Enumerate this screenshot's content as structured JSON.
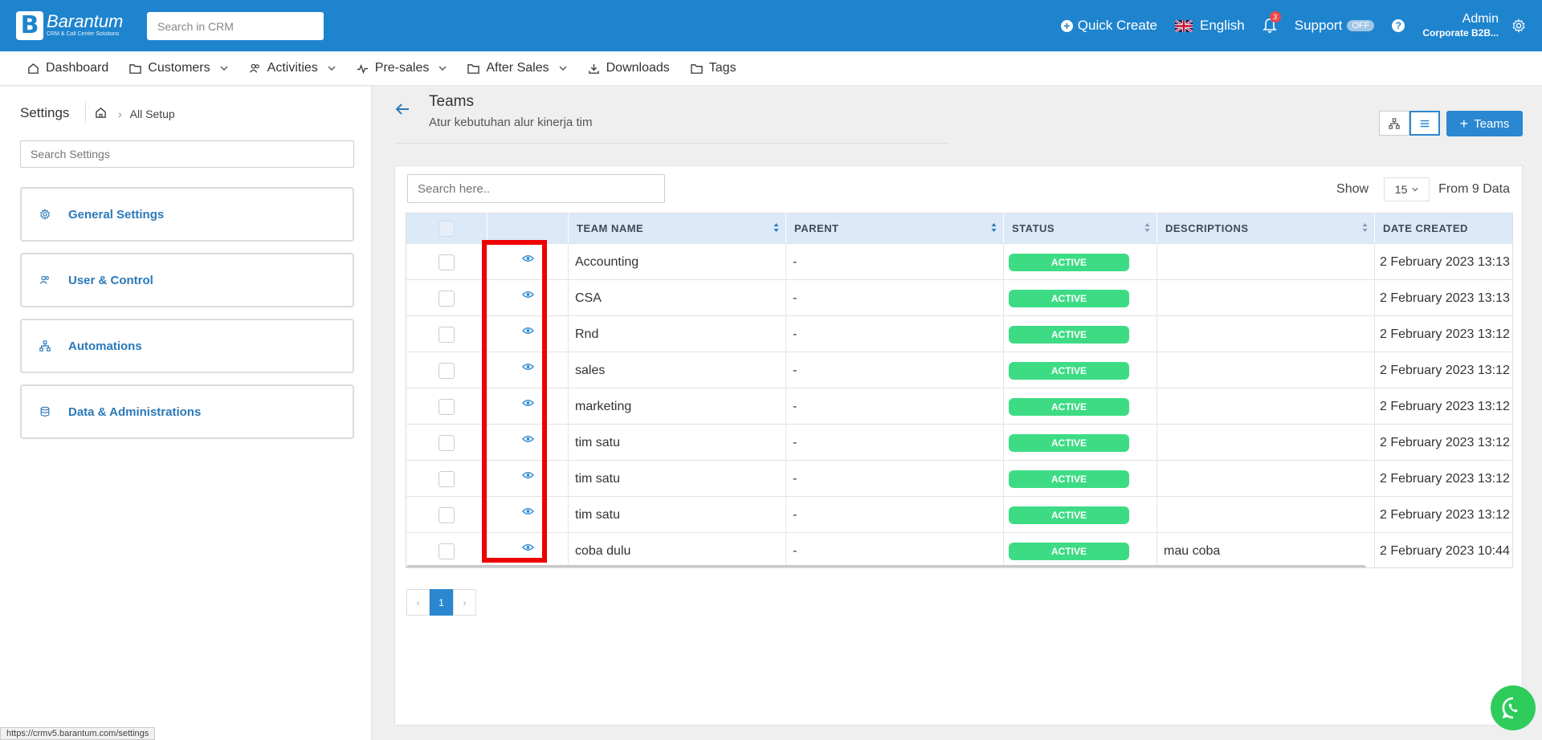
{
  "app": {
    "name": "Barantum",
    "tagline": "CRM & Call Center Solutions"
  },
  "header": {
    "search_placeholder": "Search in CRM",
    "quick_create": "Quick Create",
    "language": "English",
    "notifications_count": "3",
    "support_label": "Support",
    "support_state": "OFF",
    "user_name": "Admin",
    "user_org": "Corporate B2B..."
  },
  "nav": [
    {
      "label": "Dashboard"
    },
    {
      "label": "Customers"
    },
    {
      "label": "Activities"
    },
    {
      "label": "Pre-sales"
    },
    {
      "label": "After Sales"
    },
    {
      "label": "Downloads"
    },
    {
      "label": "Tags"
    }
  ],
  "sidebar": {
    "title": "Settings",
    "breadcrumb": "All Setup",
    "search_placeholder": "Search Settings",
    "cards": [
      {
        "label": "General Settings"
      },
      {
        "label": "User & Control"
      },
      {
        "label": "Automations"
      },
      {
        "label": "Data & Administrations"
      }
    ]
  },
  "page": {
    "title": "Teams",
    "subtitle": "Atur kebutuhan alur kinerja tim",
    "add_button": "Teams",
    "table_search_placeholder": "Search here..",
    "show_label": "Show",
    "page_size": "15",
    "total_label": "From 9 Data"
  },
  "table": {
    "columns": [
      "TEAM NAME",
      "PARENT",
      "STATUS",
      "DESCRIPTIONS",
      "DATE CREATED"
    ],
    "rows": [
      {
        "name": "Accounting",
        "parent": "-",
        "status": "ACTIVE",
        "description": "",
        "date": "2 February 2023 13:13"
      },
      {
        "name": "CSA",
        "parent": "-",
        "status": "ACTIVE",
        "description": "",
        "date": "2 February 2023 13:13"
      },
      {
        "name": "Rnd",
        "parent": "-",
        "status": "ACTIVE",
        "description": "",
        "date": "2 February 2023 13:12"
      },
      {
        "name": "sales",
        "parent": "-",
        "status": "ACTIVE",
        "description": "",
        "date": "2 February 2023 13:12"
      },
      {
        "name": "marketing",
        "parent": "-",
        "status": "ACTIVE",
        "description": "",
        "date": "2 February 2023 13:12"
      },
      {
        "name": "tim satu",
        "parent": "-",
        "status": "ACTIVE",
        "description": "",
        "date": "2 February 2023 13:12"
      },
      {
        "name": "tim satu",
        "parent": "-",
        "status": "ACTIVE",
        "description": "",
        "date": "2 February 2023 13:12"
      },
      {
        "name": "tim satu",
        "parent": "-",
        "status": "ACTIVE",
        "description": "",
        "date": "2 February 2023 13:12"
      },
      {
        "name": "coba dulu",
        "parent": "-",
        "status": "ACTIVE",
        "description": "mau coba",
        "date": "2 February 2023 10:44"
      }
    ]
  },
  "pagination": {
    "prev": "‹",
    "current": "1",
    "next": "›"
  },
  "status_url": "https://crmv5.barantum.com/settings",
  "colors": {
    "primary": "#1e84ce",
    "status_active": "#3ddc84",
    "highlight": "#ee0000"
  }
}
